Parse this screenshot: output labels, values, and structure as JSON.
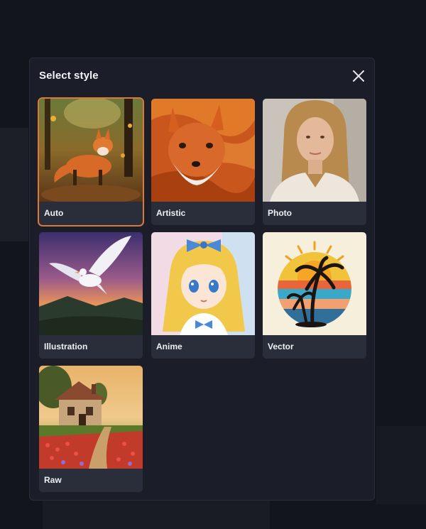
{
  "dialog": {
    "title": "Select style",
    "close_icon": "close-icon"
  },
  "styles": [
    {
      "label": "Auto",
      "selected": true,
      "thumbnail": "fox-in-autumn-forest"
    },
    {
      "label": "Artistic",
      "selected": false,
      "thumbnail": "painted-fox-portrait"
    },
    {
      "label": "Photo",
      "selected": false,
      "thumbnail": "woman-portrait-photo"
    },
    {
      "label": "Illustration",
      "selected": false,
      "thumbnail": "flying-bird-sunset"
    },
    {
      "label": "Anime",
      "selected": false,
      "thumbnail": "anime-girl-blue-bow"
    },
    {
      "label": "Vector",
      "selected": false,
      "thumbnail": "palm-tree-sunset-emblem"
    },
    {
      "label": "Raw",
      "selected": false,
      "thumbnail": "cottage-flower-field"
    }
  ],
  "colors": {
    "modal_bg": "#1b1e28",
    "card_bg": "#2a2e3b",
    "selected_outline": "#d9793a"
  }
}
